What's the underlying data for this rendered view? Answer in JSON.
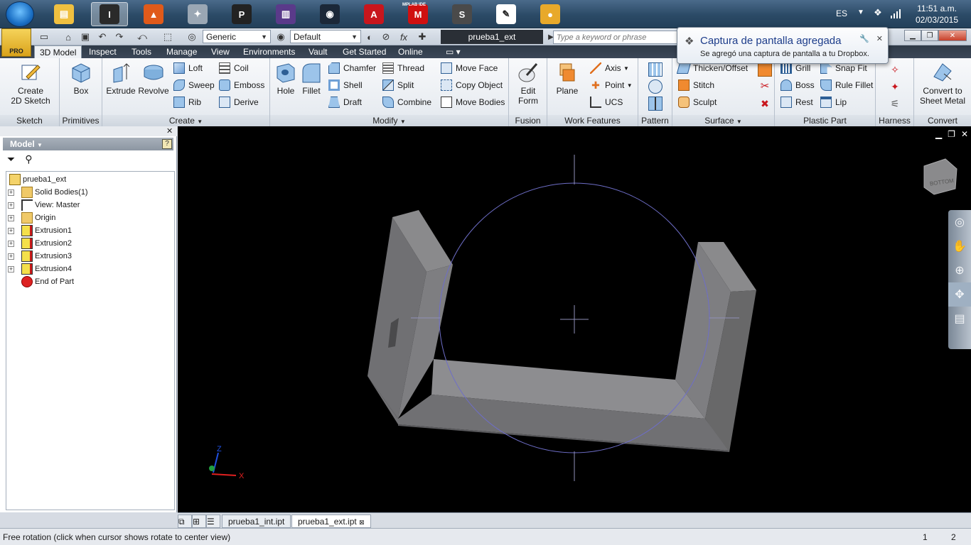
{
  "taskbar": {
    "apps": [
      {
        "name": "explorer-icon",
        "glyph": "▤",
        "color": "#f0c040"
      },
      {
        "name": "inventor-icon",
        "glyph": "I",
        "color": "#2a2a2a"
      },
      {
        "name": "matlab-icon",
        "glyph": "▲",
        "color": "#e05a1a"
      },
      {
        "name": "tool-icon",
        "glyph": "✦",
        "color": "#9aa7b4"
      },
      {
        "name": "pianoteq-icon",
        "glyph": "P",
        "color": "#222222"
      },
      {
        "name": "mixer-icon",
        "glyph": "▥",
        "color": "#5a3a8a"
      },
      {
        "name": "steam-icon",
        "glyph": "◉",
        "color": "#1b2838"
      },
      {
        "name": "autocad-icon",
        "glyph": "A",
        "color": "#c8161d"
      },
      {
        "name": "mplab-icon",
        "glyph": "M",
        "color": "#d01010"
      },
      {
        "name": "sublime-icon",
        "glyph": "S",
        "color": "#4a4a4a"
      },
      {
        "name": "inkscape-icon",
        "glyph": "✎",
        "color": "#ffffff"
      },
      {
        "name": "chrome-icon",
        "glyph": "●",
        "color": "#e8a92a"
      }
    ],
    "apps_label": "MPLAB IDE",
    "language": "ES",
    "time": "11:51 a.m.",
    "date": "02/03/2015"
  },
  "app": {
    "logo_label": "PRO",
    "material": "Generic",
    "appearance": "Default",
    "document_title": "prueba1_ext",
    "search_placeholder": "Type a keyword or phrase"
  },
  "tabs": [
    "3D Model",
    "Inspect",
    "Tools",
    "Manage",
    "View",
    "Environments",
    "Vault",
    "Get Started",
    "Online"
  ],
  "ribbon": {
    "sketch": {
      "label": "Sketch",
      "create_2d": "Create\n2D Sketch"
    },
    "primitives": {
      "label": "Primitives",
      "box": "Box"
    },
    "create": {
      "label": "Create",
      "extrude": "Extrude",
      "revolve": "Revolve",
      "loft": "Loft",
      "sweep": "Sweep",
      "rib": "Rib",
      "coil": "Coil",
      "emboss": "Emboss",
      "derive": "Derive"
    },
    "modify": {
      "label": "Modify",
      "hole": "Hole",
      "fillet": "Fillet",
      "chamfer": "Chamfer",
      "shell": "Shell",
      "draft": "Draft",
      "thread": "Thread",
      "split": "Split",
      "combine": "Combine",
      "move_face": "Move Face",
      "copy_object": "Copy Object",
      "move_bodies": "Move Bodies"
    },
    "fusion": {
      "label": "Fusion",
      "edit_form": "Edit\nForm"
    },
    "work_features": {
      "label": "Work Features",
      "plane": "Plane",
      "axis": "Axis",
      "point": "Point",
      "ucs": "UCS"
    },
    "pattern": {
      "label": "Pattern"
    },
    "surface": {
      "label": "Surface",
      "thicken": "Thicken/Offset",
      "stitch": "Stitch",
      "sculpt": "Sculpt"
    },
    "plastic_part": {
      "label": "Plastic Part",
      "grill": "Grill",
      "boss": "Boss",
      "rest": "Rest",
      "snap_fit": "Snap Fit",
      "rule_fillet": "Rule Fillet",
      "lip": "Lip"
    },
    "harness": {
      "label": "Harness"
    },
    "convert": {
      "label": "Convert",
      "sheet_metal": "Convert to\nSheet Metal"
    }
  },
  "browser": {
    "title": "Model",
    "tree": [
      {
        "label": "prueba1_ext",
        "icon": "part-icon",
        "expandable": false,
        "indent": 0
      },
      {
        "label": "Solid Bodies(1)",
        "icon": "folder-icon",
        "expandable": true,
        "indent": 1
      },
      {
        "label": "View: Master",
        "icon": "view-icon",
        "expandable": true,
        "indent": 1
      },
      {
        "label": "Origin",
        "icon": "folder-icon",
        "expandable": true,
        "indent": 1
      },
      {
        "label": "Extrusion1",
        "icon": "extrusion-icon",
        "expandable": true,
        "indent": 1
      },
      {
        "label": "Extrusion2",
        "icon": "extrusion-icon",
        "expandable": true,
        "indent": 1
      },
      {
        "label": "Extrusion3",
        "icon": "extrusion-icon",
        "expandable": true,
        "indent": 1
      },
      {
        "label": "Extrusion4",
        "icon": "extrusion-icon",
        "expandable": true,
        "indent": 1
      },
      {
        "label": "End of Part",
        "icon": "end-of-part-icon",
        "expandable": false,
        "indent": 1
      }
    ]
  },
  "viewport": {
    "background": "#000000",
    "axis_x": "X",
    "axis_z": "Z",
    "viewcube_label": "BOTTOM"
  },
  "doc_tabs": [
    "prueba1_int.ipt",
    "prueba1_ext.ipt"
  ],
  "status": {
    "text": "Free rotation (click when cursor shows rotate to center view)",
    "num1": "1",
    "num2": "2"
  },
  "toast": {
    "title": "Captura de pantalla agregada",
    "body": "Se agregó una captura de pantalla a tu Dropbox."
  }
}
